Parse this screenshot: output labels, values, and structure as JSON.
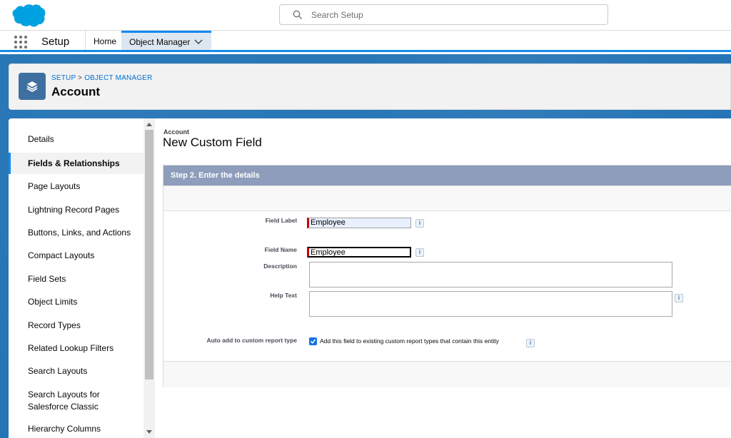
{
  "header": {
    "search_placeholder": "Search Setup"
  },
  "context_bar": {
    "app_name": "Setup",
    "tabs": [
      {
        "label": "Home"
      },
      {
        "label": "Object Manager"
      }
    ]
  },
  "page_header": {
    "breadcrumb": {
      "setup": "SETUP",
      "separator": ">",
      "object_manager": "OBJECT MANAGER"
    },
    "title": "Account"
  },
  "sidebar": {
    "items": [
      {
        "label": "Details"
      },
      {
        "label": "Fields & Relationships"
      },
      {
        "label": "Page Layouts"
      },
      {
        "label": "Lightning Record Pages"
      },
      {
        "label": "Buttons, Links, and Actions"
      },
      {
        "label": "Compact Layouts"
      },
      {
        "label": "Field Sets"
      },
      {
        "label": "Object Limits"
      },
      {
        "label": "Record Types"
      },
      {
        "label": "Related Lookup Filters"
      },
      {
        "label": "Search Layouts"
      },
      {
        "label": "Search Layouts for Salesforce Classic"
      },
      {
        "label": "Hierarchy Columns"
      }
    ],
    "active_item": "Fields & Relationships"
  },
  "main": {
    "object_label": "Account",
    "title": "New Custom Field",
    "step_header": "Step 2. Enter the details",
    "fields": {
      "field_label": {
        "label": "Field Label",
        "value": "Employee"
      },
      "field_name": {
        "label": "Field Name",
        "value": "Employee"
      },
      "description": {
        "label": "Description",
        "value": ""
      },
      "help_text": {
        "label": "Help Text",
        "value": ""
      },
      "auto_add": {
        "label": "Auto add to custom report type",
        "checkbox_text": "Add this field to existing custom report types that contain this entity",
        "checked": true
      }
    },
    "info_glyph": "i"
  },
  "colors": {
    "brand_blue": "#1589ee",
    "band_blue": "#2574b5",
    "object_icon": "#3e6fa1",
    "step_header": "#8e9dbb",
    "required": "#cc0000"
  }
}
